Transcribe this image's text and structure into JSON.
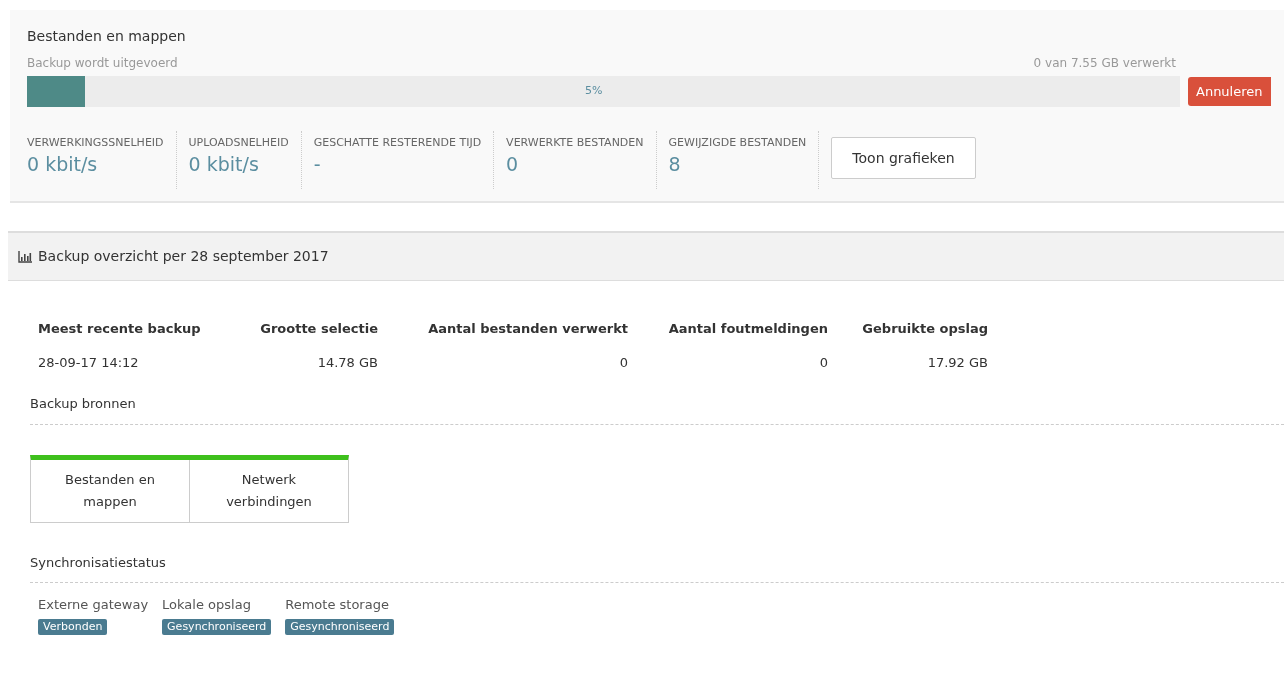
{
  "progress_panel": {
    "title": "Bestanden en mappen",
    "status": "Backup wordt uitgevoerd",
    "processed": "0 van 7.55 GB verwerkt",
    "level": 0.05,
    "percent": "5%",
    "cancel_button": "Annuleren",
    "stats": [
      {
        "label": "VERWERKINGSSNELHEID",
        "value": "0 kbit/s"
      },
      {
        "label": "UPLOADSNELHEID",
        "value": "0 kbit/s"
      },
      {
        "label": "GESCHATTE RESTERENDE TIJD",
        "value": "-"
      },
      {
        "label": "VERWERKTE BESTANDEN",
        "value": "0"
      },
      {
        "label": "GEWIJZIGDE BESTANDEN",
        "value": "8"
      }
    ],
    "charts_button": "Toon grafieken"
  },
  "overview": {
    "title": "Backup overzicht per 28 september 2017",
    "table": {
      "columns": [
        "Meest recente backup",
        "Grootte selectie",
        "Aantal bestanden verwerkt",
        "Aantal foutmeldingen",
        "Gebruikte opslag"
      ],
      "rows": [
        [
          "28-09-17 14:12",
          "14.78 GB",
          "0",
          "0",
          "17.92 GB"
        ]
      ]
    },
    "sources_heading": "Backup bronnen",
    "sources": [
      "Bestanden en mappen",
      "Netwerk verbindingen"
    ],
    "sync_heading": "Synchronisatiestatus",
    "sync": [
      {
        "name": "Externe gateway",
        "status": "Verbonden"
      },
      {
        "name": "Lokale opslag",
        "status": "Gesynchroniseerd"
      },
      {
        "name": "Remote storage",
        "status": "Gesynchroniseerd"
      }
    ]
  }
}
